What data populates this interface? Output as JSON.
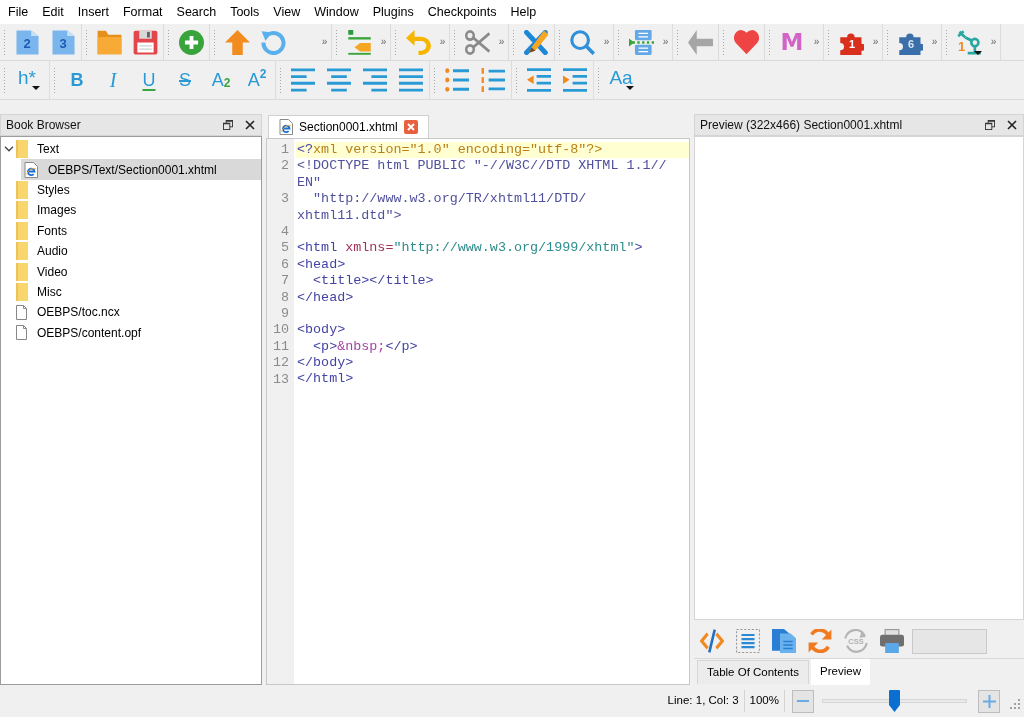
{
  "menu_bar": [
    "File",
    "Edit",
    "Insert",
    "Format",
    "Search",
    "Tools",
    "View",
    "Window",
    "Plugins",
    "Checkpoints",
    "Help"
  ],
  "main_toolbar": {
    "glyphs": [
      "2",
      "3",
      "M",
      "1",
      "6",
      "1"
    ],
    "overflow_buttons": [
      "»",
      "»",
      "»",
      "»",
      "»",
      "»",
      "»",
      "»",
      "»",
      "»"
    ]
  },
  "format_toolbar": {
    "glyphs": [
      "h*",
      "B",
      "I",
      "U",
      "S",
      "A$_{2}$",
      "A$^{2}$",
      "Aa"
    ]
  },
  "book_browser": {
    "title": "Book Browser",
    "tree": [
      {
        "label": "Text",
        "kind": "folder",
        "selected": false,
        "expanded": true,
        "children": [
          {
            "label": "OEBPS/Text/Section0001.xhtml",
            "kind": "xhtml",
            "selected": true
          }
        ]
      },
      {
        "label": "Styles",
        "kind": "folder",
        "selected": false
      },
      {
        "label": "Images",
        "kind": "folder",
        "selected": false
      },
      {
        "label": "Fonts",
        "kind": "folder",
        "selected": false
      },
      {
        "label": "Audio",
        "kind": "folder",
        "selected": false
      },
      {
        "label": "Video",
        "kind": "folder",
        "selected": false
      },
      {
        "label": "Misc",
        "kind": "folder",
        "selected": false
      },
      {
        "label": "OEBPS/toc.ncx",
        "kind": "file",
        "selected": false
      },
      {
        "label": "OEBPS/content.opf",
        "kind": "file",
        "selected": false
      }
    ]
  },
  "editor": {
    "tab": {
      "label": "Section0001.xhtml",
      "selected": true
    },
    "lines": [
      {
        "number": "1",
        "current": true,
        "rows": [
          [
            {
              "text": "<?",
              "kind": "tag"
            },
            {
              "text": "xml version=\"1.0\" encoding=\"utf-8\"?>",
              "kind": "declaration"
            }
          ]
        ]
      },
      {
        "number": "2",
        "current": false,
        "rows": [
          [
            {
              "text": "<!DOCTYPE html PUBLIC \"-//W3C//DTD XHTML 1.1//",
              "kind": "doctype"
            }
          ],
          [
            {
              "text": "EN\"",
              "kind": "doctype"
            }
          ]
        ]
      },
      {
        "number": "3",
        "current": false,
        "rows": [
          [
            {
              "text": "  \"http://www.w3.org/TR/xhtml11/DTD/",
              "kind": "doctype"
            }
          ],
          [
            {
              "text": "xhtml11.dtd\">",
              "kind": "doctype"
            }
          ]
        ]
      },
      {
        "number": "4",
        "current": false
      },
      {
        "number": "5",
        "current": false,
        "rows": [
          [
            {
              "text": "<html",
              "kind": "tag"
            },
            {
              "text": " xmlns=",
              "kind": "attribute"
            },
            {
              "text": "\"http://www.w3.org/1999/xhtml\"",
              "kind": "value"
            },
            {
              "text": ">",
              "kind": "tag"
            }
          ]
        ]
      },
      {
        "number": "6",
        "current": false,
        "rows": [
          [
            {
              "text": "<head>",
              "kind": "tag"
            }
          ]
        ]
      },
      {
        "number": "7",
        "current": false,
        "rows": [
          [
            {
              "text": "  <title></title>",
              "kind": "tag"
            }
          ]
        ]
      },
      {
        "number": "8",
        "current": false,
        "rows": [
          [
            {
              "text": "</head>",
              "kind": "tag"
            }
          ]
        ]
      },
      {
        "number": "9",
        "current": false
      },
      {
        "number": "10",
        "current": false,
        "rows": [
          [
            {
              "text": "<body>",
              "kind": "tag"
            }
          ]
        ]
      },
      {
        "number": "11",
        "current": false,
        "rows": [
          [
            {
              "text": "  <p>",
              "kind": "tag"
            },
            {
              "text": "&nbsp;",
              "kind": "entity"
            },
            {
              "text": "</p>",
              "kind": "tag"
            }
          ]
        ]
      },
      {
        "number": "12",
        "current": false,
        "rows": [
          [
            {
              "text": "</body>",
              "kind": "tag"
            }
          ]
        ]
      },
      {
        "number": "13",
        "current": false,
        "rows": [
          [
            {
              "text": "</html>",
              "kind": "tag"
            }
          ]
        ]
      }
    ]
  },
  "preview": {
    "title": "Preview (322x466) Section0001.xhtml",
    "css_button": {
      "glyph": "CSS",
      "disabled": true
    },
    "tabs": [
      {
        "label": "Table Of Contents",
        "selected": false
      },
      {
        "label": "Preview",
        "selected": true
      }
    ]
  },
  "status_bar": {
    "position": "Line: 1, Col: 3",
    "zoom": "100%",
    "zoom_slider": {
      "level": 0.5
    }
  }
}
